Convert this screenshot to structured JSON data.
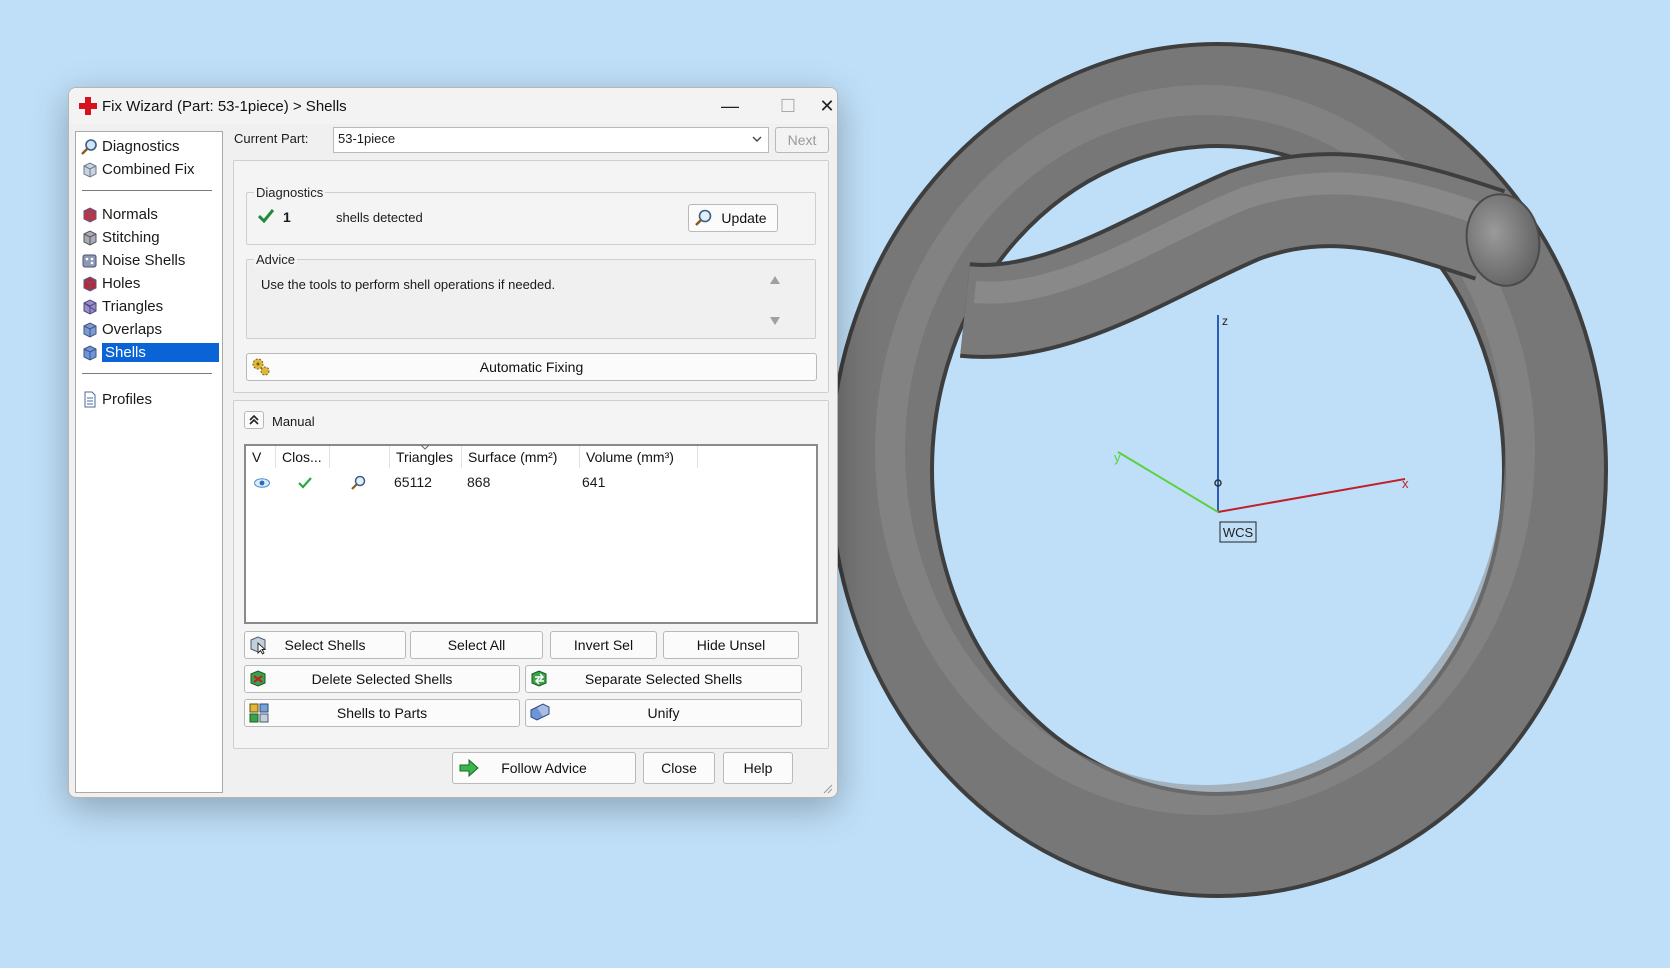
{
  "dialog": {
    "title": "Fix Wizard (Part: 53-1piece) > Shells",
    "controls": {
      "minimize": "—",
      "maximize": "☐",
      "close": "✕"
    }
  },
  "nav": {
    "items": [
      {
        "label": "Diagnostics",
        "icon": "magnifier-icon"
      },
      {
        "label": "Combined Fix",
        "icon": "cube-icon"
      },
      {
        "label": "Normals",
        "icon": "cube-red-icon"
      },
      {
        "label": "Stitching",
        "icon": "cube-grey-icon"
      },
      {
        "label": "Noise Shells",
        "icon": "dice-icon"
      },
      {
        "label": "Holes",
        "icon": "cube-red-icon"
      },
      {
        "label": "Triangles",
        "icon": "cube-purple-icon"
      },
      {
        "label": "Overlaps",
        "icon": "cube-blue-icon"
      },
      {
        "label": "Shells",
        "icon": "cube-blue-icon",
        "selected": true
      },
      {
        "label": "Profiles",
        "icon": "document-icon"
      }
    ]
  },
  "current_part": {
    "label": "Current Part:",
    "value": "53-1piece",
    "next": "Next"
  },
  "diagnostics": {
    "label": "Diagnostics",
    "count": "1",
    "text": "shells detected",
    "update": "Update"
  },
  "advice": {
    "label": "Advice",
    "text": "Use the tools to perform shell operations if needed."
  },
  "automatic_fixing": "Automatic Fixing",
  "manual": {
    "label": "Manual",
    "columns": [
      "V",
      "Clos...",
      "",
      "Triangles",
      "Surface (mm²)",
      "Volume (mm³)"
    ],
    "rows": [
      {
        "triangles": "65112",
        "surface": "868",
        "volume": "641"
      }
    ]
  },
  "actions": {
    "select_shells": "Select Shells",
    "select_all": "Select All",
    "invert_sel": "Invert Sel",
    "hide_unsel": "Hide Unsel",
    "delete_selected": "Delete Selected Shells",
    "separate_selected": "Separate Selected Shells",
    "shells_to_parts": "Shells to Parts",
    "unify": "Unify"
  },
  "footer": {
    "follow_advice": "Follow Advice",
    "close": "Close",
    "help": "Help"
  },
  "viewport": {
    "axes": {
      "x": "x",
      "y": "y",
      "z": "z"
    },
    "wcs": "WCS"
  },
  "colors": {
    "background": "#bfdff8",
    "selection": "#0a64d6",
    "x_axis": "#c0202a",
    "y_axis": "#5bd13a",
    "z_axis": "#2a5db3",
    "model": "#777777"
  }
}
